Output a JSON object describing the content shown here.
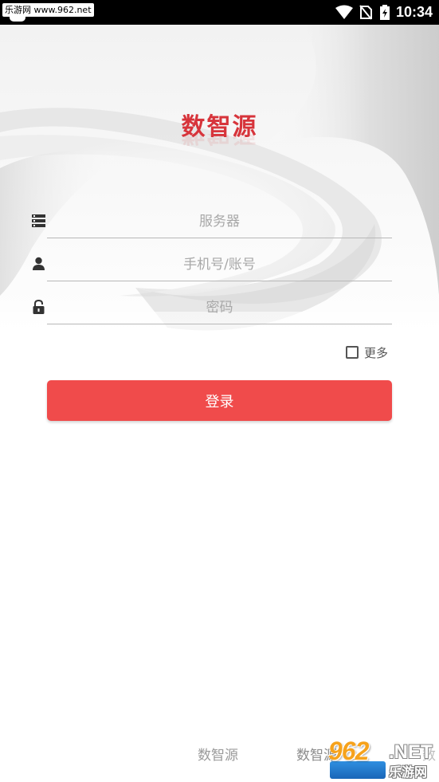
{
  "status_bar": {
    "watermark_text": "乐游网 www.962.net",
    "time": "10:34"
  },
  "app": {
    "logo_text": "数智源"
  },
  "form": {
    "server_placeholder": "服务器",
    "account_placeholder": "手机号/账号",
    "password_placeholder": "密码",
    "more_label": "更多",
    "more_checked": false,
    "login_label": "登录"
  },
  "footer": {
    "brand_1": "数智源",
    "brand_2": "数智源",
    "brand_3": "数"
  },
  "watermark": {
    "number": "962",
    "suffix": ".NET",
    "site_name": "乐游网"
  },
  "colors": {
    "accent": "#f04b4b",
    "logo": "#d7343b",
    "status_bar": "#000000"
  },
  "icons": {
    "server": "server-icon",
    "account": "user-icon",
    "password": "lock-icon"
  }
}
